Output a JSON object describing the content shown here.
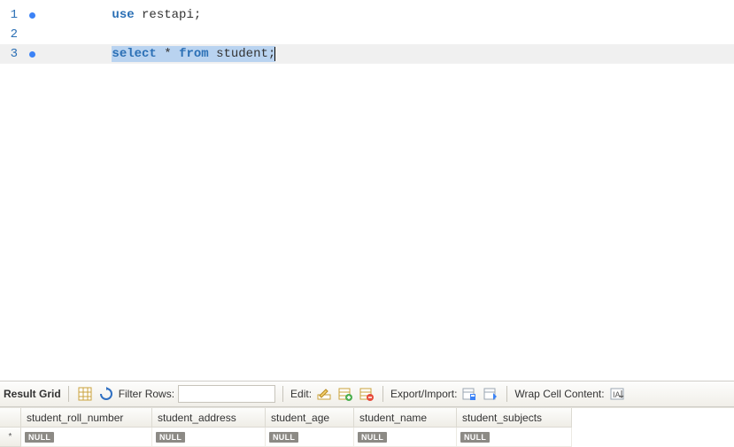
{
  "editor": {
    "lines": [
      {
        "num": "1",
        "marker": true,
        "tokens": [
          {
            "t": "use ",
            "cls": "kw"
          },
          {
            "t": "restapi;",
            "cls": "ident"
          }
        ]
      },
      {
        "num": "2",
        "marker": false,
        "tokens": []
      },
      {
        "num": "3",
        "marker": true,
        "selected": true,
        "highlighted": true,
        "tokens": [
          {
            "t": "select",
            "cls": "kw"
          },
          {
            "t": " * ",
            "cls": "ident"
          },
          {
            "t": "from",
            "cls": "kw"
          },
          {
            "t": " student;",
            "cls": "ident"
          }
        ]
      }
    ]
  },
  "toolbar": {
    "result_grid_label": "Result Grid",
    "filter_label": "Filter Rows:",
    "filter_value": "",
    "edit_label": "Edit:",
    "export_label": "Export/Import:",
    "wrap_label": "Wrap Cell Content:"
  },
  "grid": {
    "columns": [
      "student_roll_number",
      "student_address",
      "student_age",
      "student_name",
      "student_subjects"
    ],
    "null_label": "NULL",
    "row_marker": "*"
  }
}
